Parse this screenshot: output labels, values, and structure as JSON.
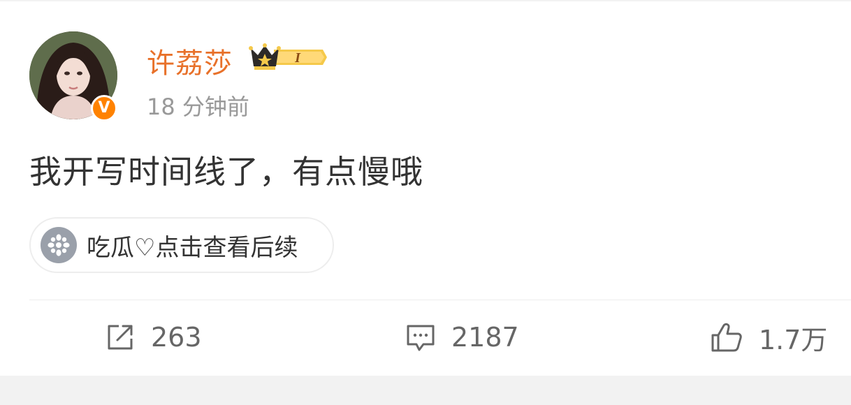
{
  "post": {
    "username": "许荔莎",
    "vip_level": "I",
    "timestamp": "18 分钟前",
    "verified_mark": "V",
    "content": "我开写时间线了，有点慢哦",
    "topic_chip": "吃瓜♡点击查看后续"
  },
  "actions": {
    "repost_count": "263",
    "comment_count": "2187",
    "like_count": "1.7万"
  },
  "icons": {
    "repost": "share-edit-icon",
    "comment": "comment-bubble-icon",
    "like": "thumbs-up-icon",
    "verified": "verified-badge-icon",
    "vip": "crown-vip-icon",
    "topic": "flower-icon"
  },
  "colors": {
    "username": "#e8712a",
    "verified_badge": "#ff8200",
    "secondary_text": "#999999",
    "body_text": "#333333",
    "vip_gold": "#f5c94a",
    "background": "#ffffff"
  }
}
